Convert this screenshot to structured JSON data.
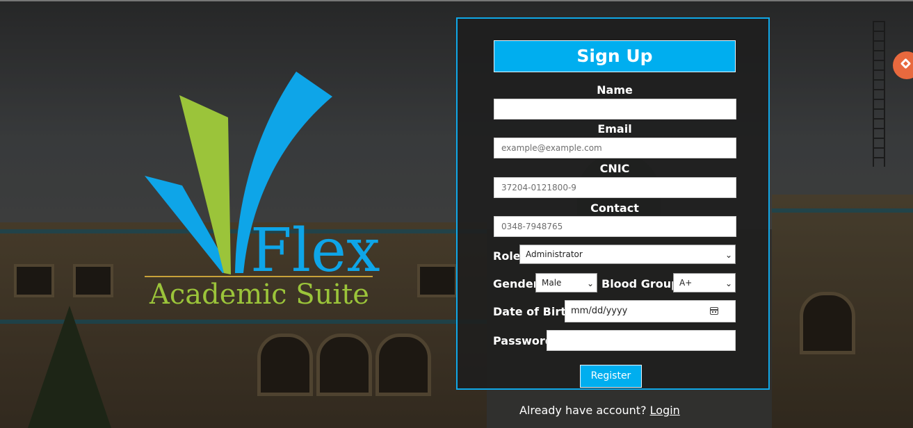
{
  "brand": {
    "line1": "Flex",
    "line2": "Academic Suite"
  },
  "colors": {
    "accent": "#00aeef",
    "logo_blue": "#0ea5e8",
    "logo_green": "#9bc43a",
    "card_bg": "#1e1e1e"
  },
  "form": {
    "title": "Sign Up",
    "name": {
      "label": "Name",
      "value": "",
      "placeholder": ""
    },
    "email": {
      "label": "Email",
      "value": "",
      "placeholder": "example@example.com"
    },
    "cnic": {
      "label": "CNIC",
      "value": "",
      "placeholder": "37204-0121800-9"
    },
    "contact": {
      "label": "Contact",
      "value": "",
      "placeholder": "0348-7948765"
    },
    "role": {
      "label": "Role",
      "selected": "Administrator"
    },
    "gender": {
      "label": "Gender",
      "selected": "Male"
    },
    "blood_group": {
      "label": "Blood Group",
      "selected": "A+"
    },
    "dob": {
      "label": "Date of Birth",
      "value": "mm/dd/yyyy"
    },
    "password": {
      "label": "Password",
      "value": ""
    },
    "submit_label": "Register"
  },
  "footer": {
    "text": "Already have account?",
    "link": "Login"
  },
  "icons": {
    "fab": "diamond-icon",
    "calendar": "calendar-icon",
    "dropdown": "chevron-down-icon"
  }
}
